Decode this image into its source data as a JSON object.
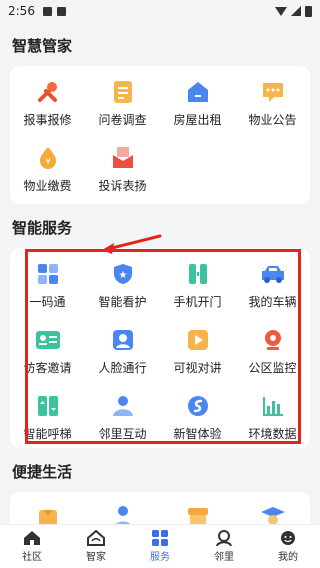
{
  "status": {
    "time": "2:56"
  },
  "colors": {
    "accent": "#3b6ee8",
    "highlight": "#e1251b"
  },
  "sections": {
    "management": {
      "title": "智慧管家",
      "items": [
        {
          "label": "报事报修",
          "icon": "wrench-icon"
        },
        {
          "label": "问卷调查",
          "icon": "survey-icon"
        },
        {
          "label": "房屋出租",
          "icon": "house-icon"
        },
        {
          "label": "物业公告",
          "icon": "notice-icon"
        },
        {
          "label": "物业缴费",
          "icon": "payment-icon"
        },
        {
          "label": "投诉表扬",
          "icon": "mail-icon"
        }
      ]
    },
    "services": {
      "title": "智能服务",
      "items": [
        {
          "label": "一码通",
          "icon": "grid-code-icon"
        },
        {
          "label": "智能看护",
          "icon": "shield-icon"
        },
        {
          "label": "手机开门",
          "icon": "door-icon"
        },
        {
          "label": "我的车辆",
          "icon": "car-icon"
        },
        {
          "label": "访客邀请",
          "icon": "visitor-card-icon"
        },
        {
          "label": "人脸通行",
          "icon": "face-icon"
        },
        {
          "label": "可视对讲",
          "icon": "video-icon"
        },
        {
          "label": "公区监控",
          "icon": "camera-icon"
        },
        {
          "label": "智能呼梯",
          "icon": "elevator-icon"
        },
        {
          "label": "邻里互动",
          "icon": "people-icon"
        },
        {
          "label": "新智体验",
          "icon": "experience-icon"
        },
        {
          "label": "环境数据",
          "icon": "chart-icon"
        }
      ]
    },
    "life": {
      "title": "便捷生活",
      "items": [
        {
          "icon": "housekeeping-icon"
        },
        {
          "icon": "person-icon"
        },
        {
          "icon": "shop-icon"
        },
        {
          "icon": "graduate-icon"
        }
      ]
    }
  },
  "nav": [
    {
      "label": "社区",
      "icon": "home-icon"
    },
    {
      "label": "智家",
      "icon": "smart-home-icon"
    },
    {
      "label": "服务",
      "icon": "services-icon",
      "active": true
    },
    {
      "label": "邻里",
      "icon": "neighbor-icon"
    },
    {
      "label": "我的",
      "icon": "profile-icon"
    }
  ]
}
